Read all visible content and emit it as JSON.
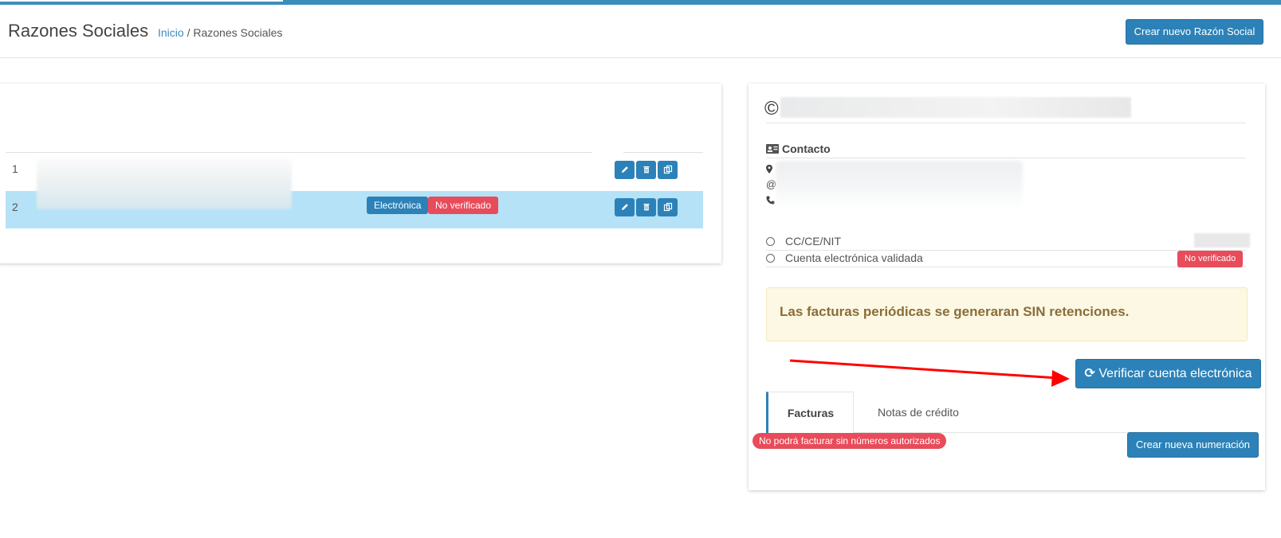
{
  "header": {
    "title": "Razones Sociales",
    "breadcrumb_home": "Inicio",
    "breadcrumb_sep": " / ",
    "breadcrumb_current": "Razones Sociales",
    "create_button": "Crear nuevo Razón Social"
  },
  "table": {
    "rows": [
      {
        "num": "1",
        "badges": []
      },
      {
        "num": "2",
        "badges": [
          "Electrónica",
          "No verificado"
        ]
      }
    ]
  },
  "detail": {
    "title_prefix": "©",
    "contact_label": "Contacto",
    "contact_icons": [
      "map-marker-icon",
      "at-icon",
      "phone-icon"
    ],
    "id_label": "CC/CE/NIT",
    "account_label": "Cuenta electrónica validada",
    "account_status": "No verificado",
    "alert_text": "Las facturas periódicas se generaran SIN retenciones.",
    "verify_button": "Verificar cuenta electrónica",
    "tabs": [
      "Facturas",
      "Notas de crédito"
    ],
    "warning_pill": "No podrá facturar sin números autorizados",
    "numeracion_button": "Crear nueva numeración"
  },
  "colors": {
    "primary": "#2c82b8",
    "danger": "#e84c5a",
    "selected_row": "#b5e2f7",
    "alert_bg": "#fcf8e3",
    "alert_text": "#8a6d3b",
    "annotation_arrow": "#ff0000"
  }
}
